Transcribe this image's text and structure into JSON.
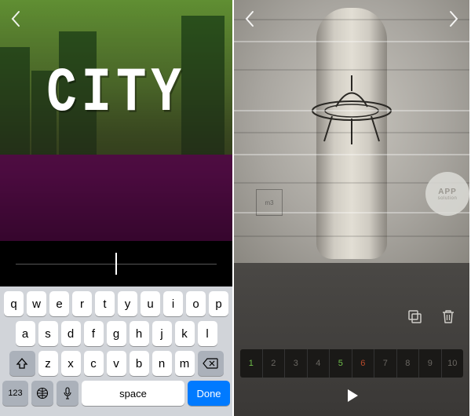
{
  "left": {
    "back_label": "back",
    "overlay_text": "CITY",
    "slider": {
      "value": 0.5
    },
    "keyboard": {
      "row1": [
        "q",
        "w",
        "e",
        "r",
        "t",
        "y",
        "u",
        "i",
        "o",
        "p"
      ],
      "row2": [
        "a",
        "s",
        "d",
        "f",
        "g",
        "h",
        "j",
        "k",
        "l"
      ],
      "row3": [
        "z",
        "x",
        "c",
        "v",
        "b",
        "n",
        "m"
      ],
      "shift_icon": "shift",
      "backspace_icon": "backspace",
      "numswitch_label": "123",
      "globe_icon": "globe",
      "mic_icon": "mic",
      "space_label": "space",
      "done_label": "Done"
    }
  },
  "right": {
    "prev_label": "previous",
    "next_label": "next",
    "watermark": "m3",
    "badge_line1": "APP",
    "badge_line2": "solution",
    "tools": {
      "duplicate_icon": "duplicate",
      "trash_icon": "trash"
    },
    "frames": {
      "cells": [
        "1",
        "2",
        "3",
        "4",
        "5",
        "6",
        "7",
        "8",
        "9",
        "10"
      ],
      "active_green": [
        0,
        4
      ],
      "active_red": [
        5
      ]
    },
    "play_icon": "play"
  }
}
